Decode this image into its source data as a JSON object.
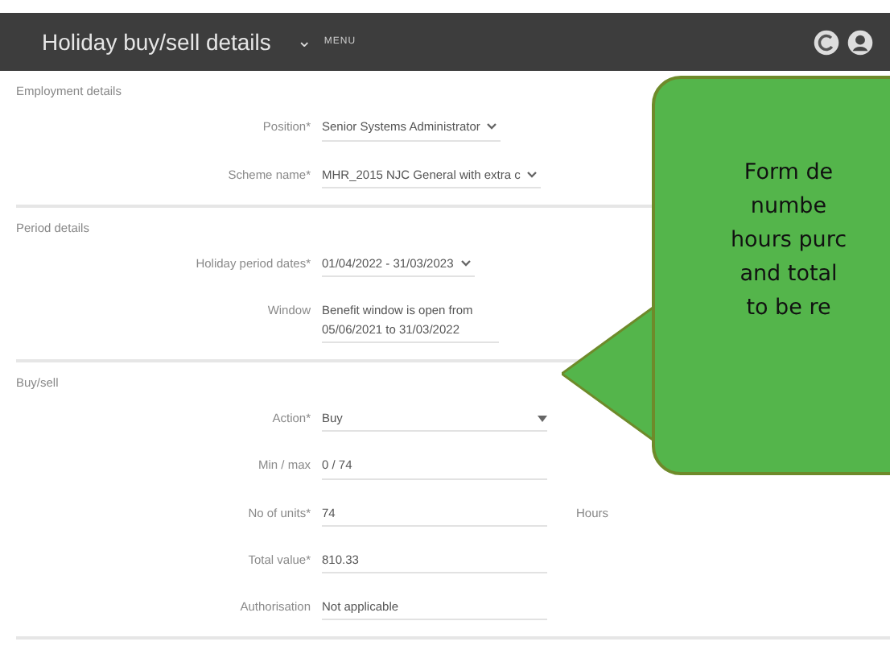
{
  "header": {
    "title": "Holiday buy/sell details",
    "menu_caret": "⌄",
    "menu_label": "MENU"
  },
  "sections": [
    {
      "title": "Employment details",
      "fields": [
        {
          "label": "Position*",
          "value": "Senior Systems Administrator",
          "kind": "select"
        },
        {
          "label": "Scheme name*",
          "value": "MHR_2015 NJC General with extra c",
          "kind": "select"
        }
      ]
    },
    {
      "title": "Period details",
      "fields": [
        {
          "label": "Holiday period dates*",
          "value": "01/04/2022 - 31/03/2023",
          "kind": "select"
        },
        {
          "label": "Window",
          "value": "Benefit window is open from 05/06/2021 to 31/03/2022",
          "kind": "text"
        }
      ]
    },
    {
      "title": "Buy/sell",
      "fields": [
        {
          "label": "Action*",
          "value": "Buy",
          "kind": "dropdown"
        },
        {
          "label": "Min / max",
          "value": "0 / 74",
          "kind": "text"
        },
        {
          "label": "No of units*",
          "value": "74",
          "kind": "text",
          "unit": "Hours"
        },
        {
          "label": "Total value*",
          "value": "810.33",
          "kind": "text"
        },
        {
          "label": "Authorisation",
          "value": "Not applicable",
          "kind": "text"
        }
      ]
    }
  ],
  "callout": {
    "lines": [
      "Form de",
      "numbe",
      "hours purc",
      "and total",
      "to be re"
    ]
  }
}
